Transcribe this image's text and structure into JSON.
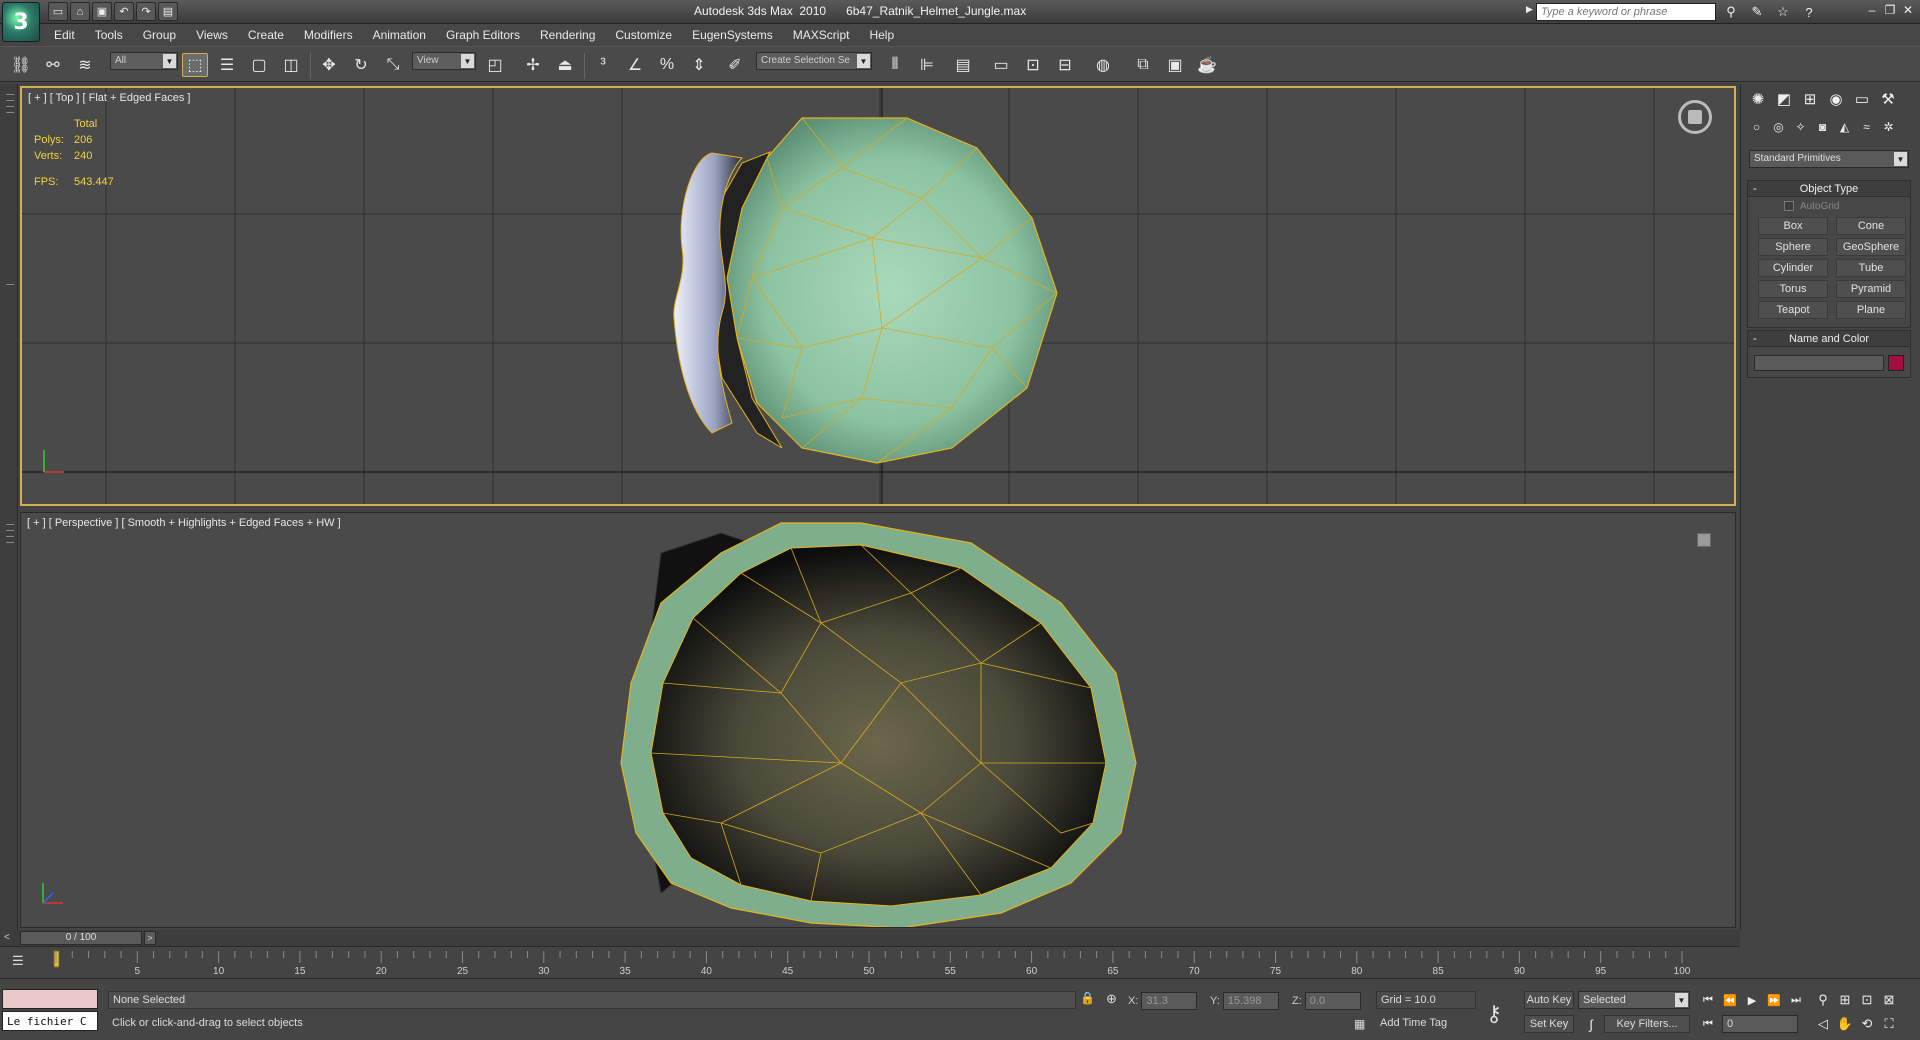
{
  "app": {
    "title": "Autodesk 3ds Max  2010      6b47_Ratnik_Helmet_Jungle.max",
    "logo": "3"
  },
  "quick_access": [
    "new-file-icon",
    "open-file-icon",
    "save-icon",
    "undo-icon",
    "redo-icon",
    "project-folder-icon"
  ],
  "search": {
    "placeholder": "Type a keyword or phrase"
  },
  "menu": [
    "Edit",
    "Tools",
    "Group",
    "Views",
    "Create",
    "Modifiers",
    "Animation",
    "Graph Editors",
    "Rendering",
    "Customize",
    "EugenSystems",
    "MAXScript",
    "Help"
  ],
  "toolbar": {
    "selection_filter": "All",
    "ref_coord": "View",
    "named_selection": "Create Selection Se"
  },
  "viewports": {
    "top": {
      "label": "[ + ] [ Top ] [ Flat + Edged Faces ]",
      "stats": {
        "header": "Total",
        "polys_label": "Polys:",
        "polys": "206",
        "verts_label": "Verts:",
        "verts": "240",
        "fps_label": "FPS:",
        "fps": "543.447"
      }
    },
    "perspective": {
      "label": "[ + ] [ Perspective ] [ Smooth + Highlights + Edged Faces + HW ]"
    }
  },
  "command_panel": {
    "category": "Standard Primitives",
    "object_type": {
      "title": "Object Type",
      "autogrid": "AutoGrid",
      "buttons": [
        "Box",
        "Cone",
        "Sphere",
        "GeoSphere",
        "Cylinder",
        "Tube",
        "Torus",
        "Pyramid",
        "Teapot",
        "Plane"
      ]
    },
    "name_color": {
      "title": "Name and Color",
      "color": "#a31040"
    }
  },
  "time_slider": {
    "position": "0 / 100",
    "prev": "<",
    "next": ">",
    "frame_ticks": [
      "5",
      "10",
      "15",
      "20",
      "25",
      "30",
      "35",
      "40",
      "45",
      "50",
      "55",
      "60",
      "65",
      "70",
      "75",
      "80",
      "85",
      "90",
      "95",
      "100"
    ]
  },
  "status": {
    "maxscript_output": "Le fichier C",
    "selection": "None Selected",
    "prompt": "Click or click-and-drag to select objects",
    "x_label": "X:",
    "x": "31.3",
    "y_label": "Y:",
    "y": "15.398",
    "z_label": "Z:",
    "z": "0.0",
    "grid": "Grid = 10.0",
    "add_time_tag": "Add Time Tag",
    "auto_key": "Auto Key",
    "set_key": "Set Key",
    "key_filters": "Key Filters...",
    "selected": "Selected",
    "current_frame": "0"
  },
  "colors": {
    "active_border": "#d6b050",
    "wireframe": "#e6b31e",
    "stats_text": "#f2d040",
    "helmet_green": "#8fc9a6"
  }
}
